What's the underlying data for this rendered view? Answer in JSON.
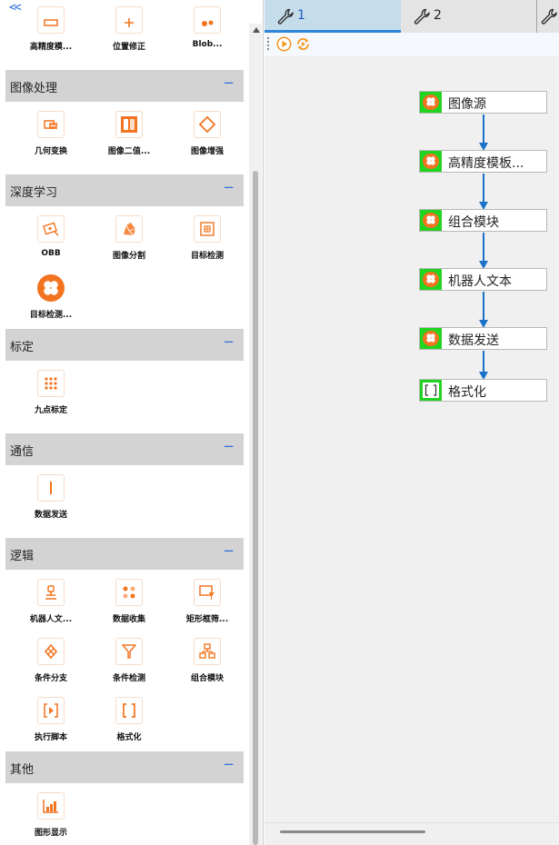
{
  "toolbox": {
    "collapse_label": "<<",
    "partial_row": [
      {
        "label": "高精度模...",
        "icon": "template-match-icon"
      },
      {
        "label": "位置修正",
        "icon": "position-fix-icon"
      },
      {
        "label": "Blob...",
        "icon": "blob-icon"
      }
    ],
    "categories": [
      {
        "title": "图像处理",
        "toggle": "−",
        "tools": [
          {
            "label": "几何变换",
            "icon": "geometric-transform-icon"
          },
          {
            "label": "图像二值...",
            "icon": "binarize-icon"
          },
          {
            "label": "图像增强",
            "icon": "enhance-icon"
          }
        ]
      },
      {
        "title": "深度学习",
        "toggle": "−",
        "tools": [
          {
            "label": "OBB",
            "icon": "obb-icon"
          },
          {
            "label": "图像分割",
            "icon": "segmentation-icon"
          },
          {
            "label": "目标检测",
            "icon": "object-detection-icon"
          },
          {
            "label": "目标检测...",
            "icon": "object-detection-module-icon"
          }
        ]
      },
      {
        "title": "标定",
        "toggle": "−",
        "tools": [
          {
            "label": "九点标定",
            "icon": "nine-point-calibration-icon"
          }
        ]
      },
      {
        "title": "通信",
        "toggle": "−",
        "tools": [
          {
            "label": "数据发送",
            "icon": "data-send-icon"
          }
        ]
      },
      {
        "title": "逻辑",
        "toggle": "−",
        "tools": [
          {
            "label": "机器人文...",
            "icon": "robot-text-icon"
          },
          {
            "label": "数据收集",
            "icon": "data-collect-icon"
          },
          {
            "label": "矩形框筛...",
            "icon": "rect-filter-icon"
          },
          {
            "label": "条件分支",
            "icon": "condition-branch-icon"
          },
          {
            "label": "条件检测",
            "icon": "condition-check-icon"
          },
          {
            "label": "组合模块",
            "icon": "group-module-icon"
          },
          {
            "label": "执行脚本",
            "icon": "script-icon"
          },
          {
            "label": "格式化",
            "icon": "format-icon"
          }
        ]
      },
      {
        "title": "其他",
        "toggle": "−",
        "tools": [
          {
            "label": "图形显示",
            "icon": "chart-display-icon"
          }
        ]
      }
    ]
  },
  "tabs": [
    {
      "label": "1",
      "icon": "wrench-icon",
      "active": true
    },
    {
      "label": "2",
      "icon": "wrench-icon",
      "active": false
    },
    {
      "label": "",
      "icon": "wrench-icon",
      "active": false
    }
  ],
  "flow_toolbar": [
    {
      "name": "run-once-button",
      "icon": "play-icon"
    },
    {
      "name": "run-loop-button",
      "icon": "loop-icon"
    }
  ],
  "flow_nodes": [
    {
      "label": "图像源",
      "icon": "module-icon"
    },
    {
      "label": "高精度模板...",
      "icon": "module-icon"
    },
    {
      "label": "组合模块",
      "icon": "module-icon"
    },
    {
      "label": "机器人文本",
      "icon": "module-icon"
    },
    {
      "label": "数据发送",
      "icon": "module-icon"
    },
    {
      "label": "格式化",
      "icon": "bracket-icon"
    }
  ],
  "colors": {
    "accent_orange": "#f37420",
    "node_icon_green": "#21d421",
    "link_blue": "#1a73c8",
    "active_tab": "#c5dceb",
    "category_header": "#d3d3d3"
  }
}
